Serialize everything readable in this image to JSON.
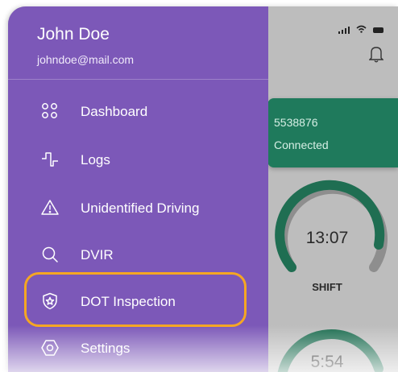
{
  "user": {
    "name": "John Doe",
    "email": "johndoe@mail.com"
  },
  "menu": {
    "items": [
      {
        "label": "Dashboard",
        "icon": "dashboard-icon"
      },
      {
        "label": "Logs",
        "icon": "logs-icon"
      },
      {
        "label": "Unidentified Driving",
        "icon": "warning-icon"
      },
      {
        "label": "DVIR",
        "icon": "search-icon"
      },
      {
        "label": "DOT Inspection",
        "icon": "shield-star-icon"
      },
      {
        "label": "Settings",
        "icon": "settings-icon"
      }
    ],
    "highlighted": "DOT Inspection"
  },
  "background": {
    "device_id": "5538876",
    "connection_status": "Connected",
    "shift_time": "13:07",
    "shift_label": "SHIFT",
    "second_time": "5:54"
  },
  "colors": {
    "drawer": "#7c58b8",
    "accent_green": "#1f7a5c",
    "highlight": "#f5a623"
  }
}
